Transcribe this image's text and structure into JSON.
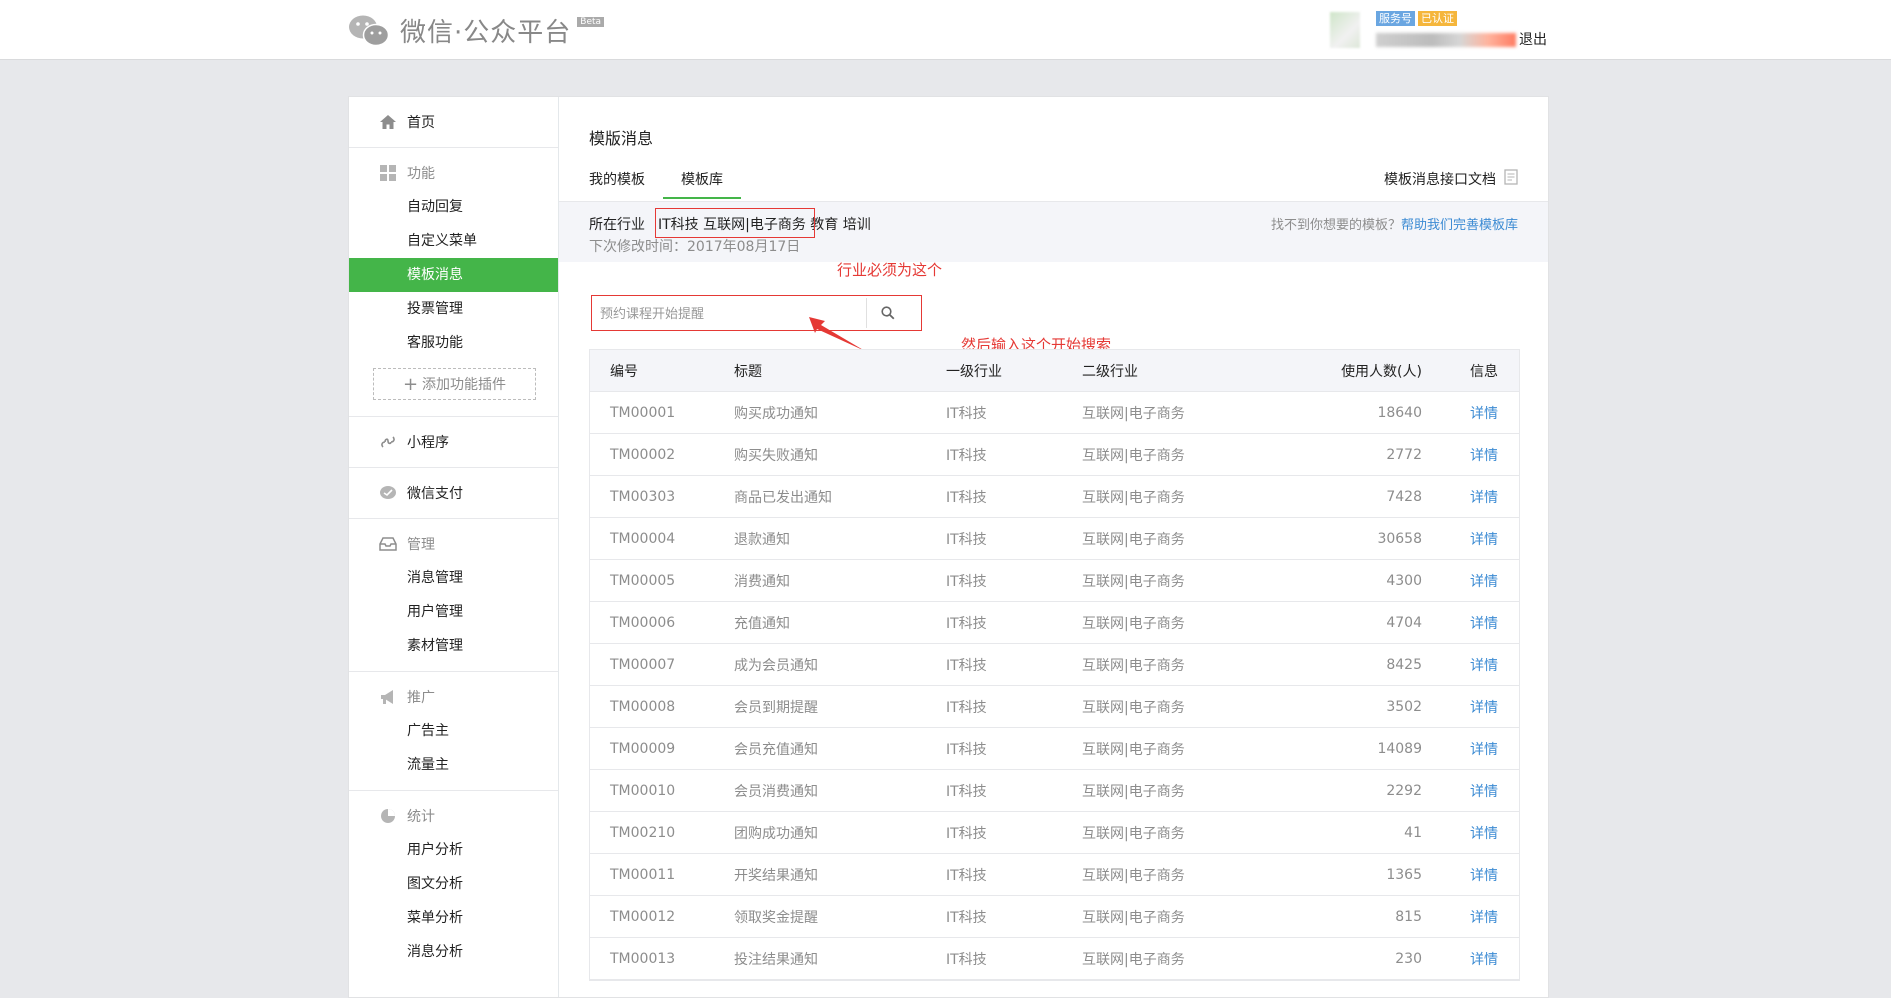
{
  "header": {
    "logo_text": "微信·公众平台",
    "beta": "Beta",
    "badge_service": "服务号",
    "badge_verified": "已认证",
    "logout": "退出"
  },
  "sidebar": {
    "home": "首页",
    "features": {
      "label": "功能",
      "items": [
        "自动回复",
        "自定义菜单",
        "模板消息",
        "投票管理",
        "客服功能"
      ],
      "active_index": 2
    },
    "add_plugin": "添加功能插件",
    "mini_program": "小程序",
    "wechat_pay": "微信支付",
    "manage": {
      "label": "管理",
      "items": [
        "消息管理",
        "用户管理",
        "素材管理"
      ]
    },
    "promotion": {
      "label": "推广",
      "items": [
        "广告主",
        "流量主"
      ]
    },
    "stats": {
      "label": "统计",
      "items": [
        "用户分析",
        "图文分析",
        "菜单分析",
        "消息分析"
      ]
    }
  },
  "main": {
    "title": "模版消息",
    "tabs": [
      "我的模板",
      "模板库"
    ],
    "active_tab": 1,
    "doc_link": "模板消息接口文档",
    "industry_label": "所在行业",
    "industry_values": "IT科技 互联网|电子商务  教育 培训",
    "next_modify": "下次修改时间：2017年08月17日",
    "help_text": "找不到你想要的模板？",
    "help_link": "帮助我们完善模板库",
    "search_placeholder": "预约课程开始提醒",
    "annotations": {
      "industry": "行业必须为这个",
      "search": "然后输入这个开始搜索"
    }
  },
  "table": {
    "headers": [
      "编号",
      "标题",
      "一级行业",
      "二级行业",
      "使用人数(人)",
      "信息"
    ],
    "rows": [
      [
        "TM00001",
        "购买成功通知",
        "IT科技",
        "互联网|电子商务",
        "18640",
        "详情"
      ],
      [
        "TM00002",
        "购买失败通知",
        "IT科技",
        "互联网|电子商务",
        "2772",
        "详情"
      ],
      [
        "TM00303",
        "商品已发出通知",
        "IT科技",
        "互联网|电子商务",
        "7428",
        "详情"
      ],
      [
        "TM00004",
        "退款通知",
        "IT科技",
        "互联网|电子商务",
        "30658",
        "详情"
      ],
      [
        "TM00005",
        "消费通知",
        "IT科技",
        "互联网|电子商务",
        "4300",
        "详情"
      ],
      [
        "TM00006",
        "充值通知",
        "IT科技",
        "互联网|电子商务",
        "4704",
        "详情"
      ],
      [
        "TM00007",
        "成为会员通知",
        "IT科技",
        "互联网|电子商务",
        "8425",
        "详情"
      ],
      [
        "TM00008",
        "会员到期提醒",
        "IT科技",
        "互联网|电子商务",
        "3502",
        "详情"
      ],
      [
        "TM00009",
        "会员充值通知",
        "IT科技",
        "互联网|电子商务",
        "14089",
        "详情"
      ],
      [
        "TM00010",
        "会员消费通知",
        "IT科技",
        "互联网|电子商务",
        "2292",
        "详情"
      ],
      [
        "TM00210",
        "团购成功通知",
        "IT科技",
        "互联网|电子商务",
        "41",
        "详情"
      ],
      [
        "TM00011",
        "开奖结果通知",
        "IT科技",
        "互联网|电子商务",
        "1365",
        "详情"
      ],
      [
        "TM00012",
        "领取奖金提醒",
        "IT科技",
        "互联网|电子商务",
        "815",
        "详情"
      ],
      [
        "TM00013",
        "投注结果通知",
        "IT科技",
        "互联网|电子商务",
        "230",
        "详情"
      ]
    ]
  }
}
